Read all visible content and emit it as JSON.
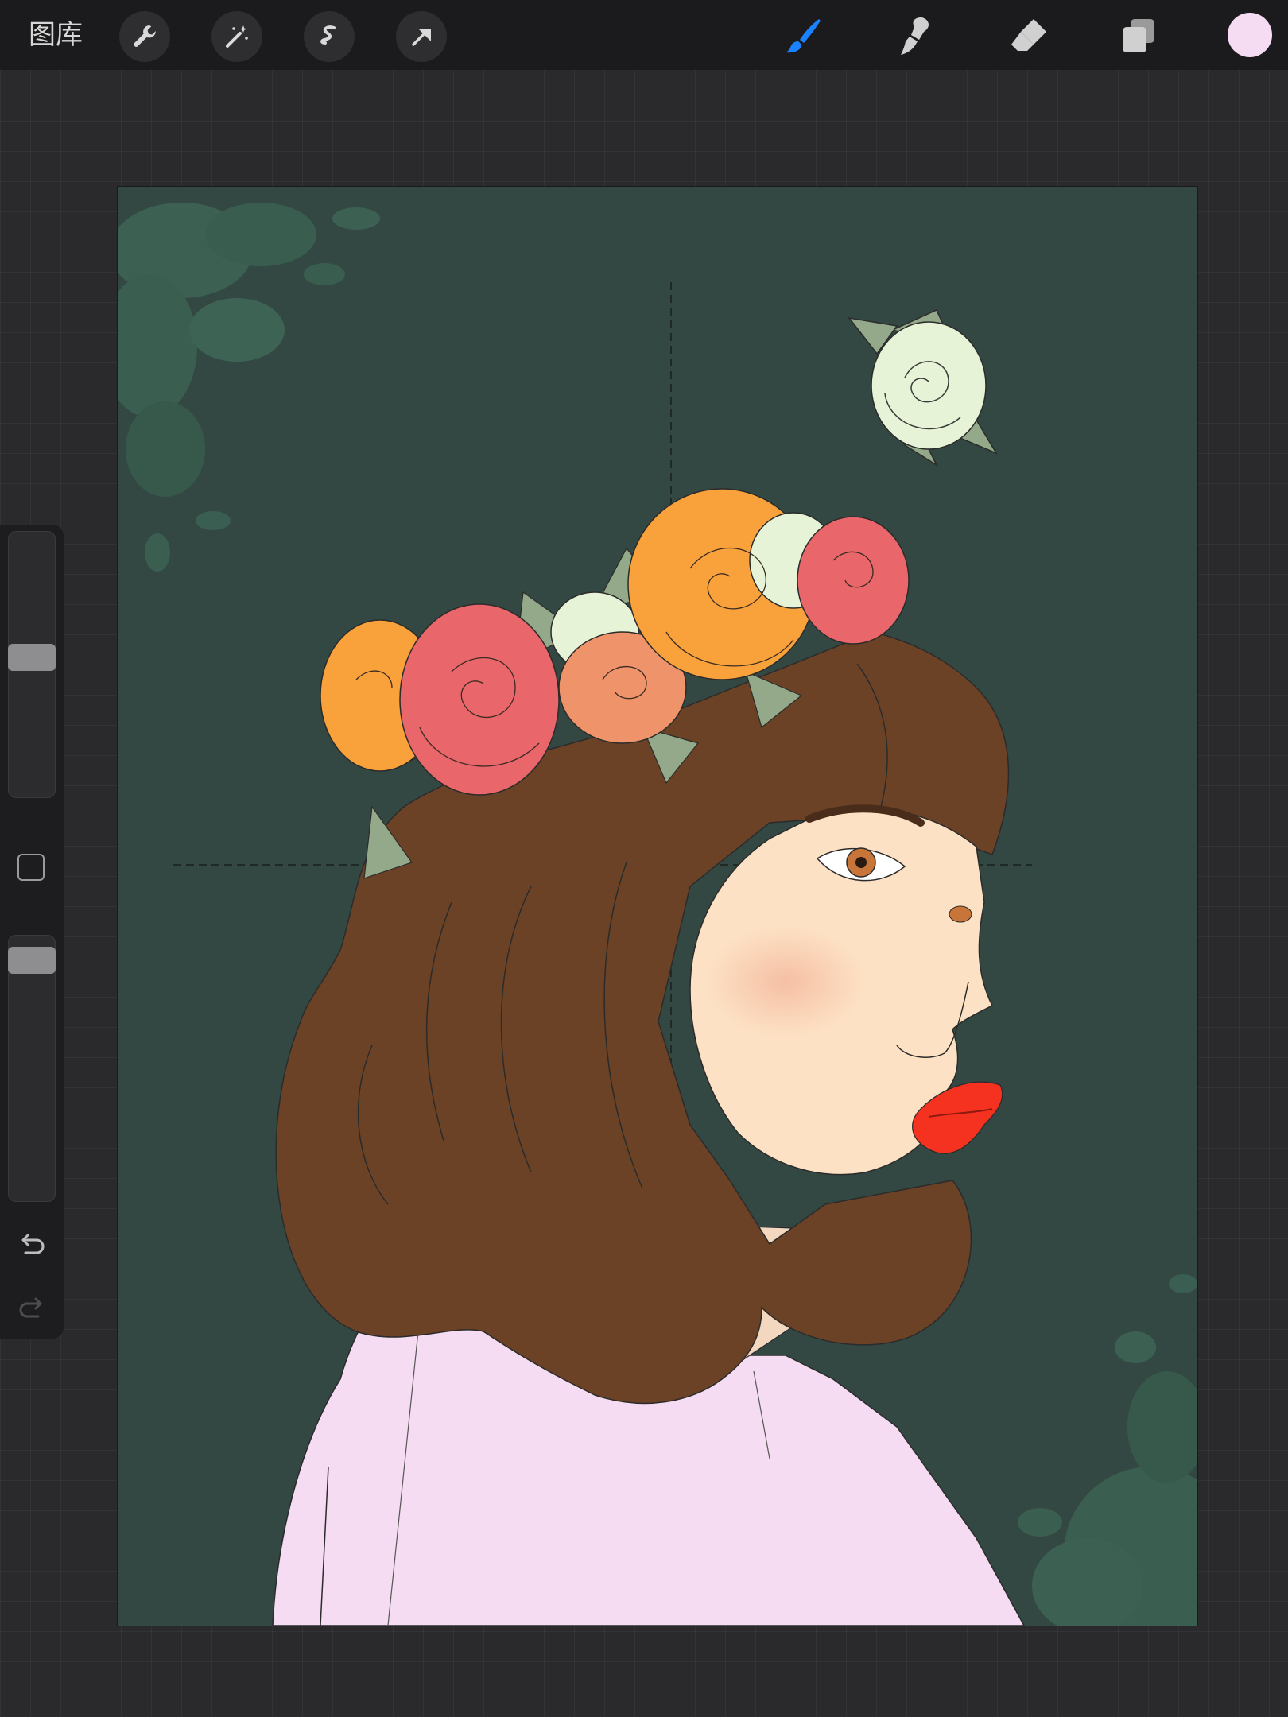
{
  "toolbar": {
    "gallery_label": "图库",
    "left_tools": [
      "wrench-icon",
      "magic-wand-icon",
      "selection-icon",
      "transform-arrow-icon"
    ],
    "right_tools": [
      "brush-icon",
      "smudge-icon",
      "eraser-icon",
      "layers-icon"
    ],
    "active_tool": "brush-icon",
    "current_color": "#f5dcf2",
    "accent_color": "#1a82ff"
  },
  "sidebar": {
    "brush_size_level": 0.53,
    "opacity_level": 0.95,
    "modifier_button": "modifier-square",
    "undo_icon": "undo-icon",
    "redo_icon": "redo-icon"
  },
  "canvas": {
    "background_color": "#334843",
    "subject": "portrait-of-woman-with-flower-crown"
  }
}
